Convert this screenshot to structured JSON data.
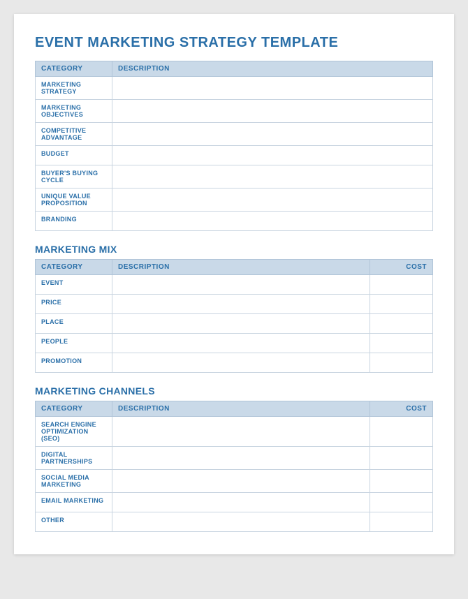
{
  "title": "EVENT MARKETING STRATEGY TEMPLATE",
  "section1": {
    "title": null,
    "headers": [
      "CATEGORY",
      "DESCRIPTION"
    ],
    "rows": [
      "MARKETING STRATEGY",
      "MARKETING OBJECTIVES",
      "COMPETITIVE ADVANTAGE",
      "BUDGET",
      "BUYER'S BUYING CYCLE",
      "UNIQUE VALUE PROPOSITION",
      "BRANDING"
    ]
  },
  "section2": {
    "title": "MARKETING MIX",
    "headers": [
      "CATEGORY",
      "DESCRIPTION",
      "COST"
    ],
    "rows": [
      "EVENT",
      "PRICE",
      "PLACE",
      "PEOPLE",
      "PROMOTION"
    ]
  },
  "section3": {
    "title": "MARKETING CHANNELS",
    "headers": [
      "CATEGORY",
      "DESCRIPTION",
      "COST"
    ],
    "rows": [
      "SEARCH ENGINE OPTIMIZATION (SEO)",
      "DIGITAL PARTNERSHIPS",
      "SOCIAL MEDIA MARKETING",
      "EMAIL MARKETING",
      "OTHER"
    ]
  }
}
